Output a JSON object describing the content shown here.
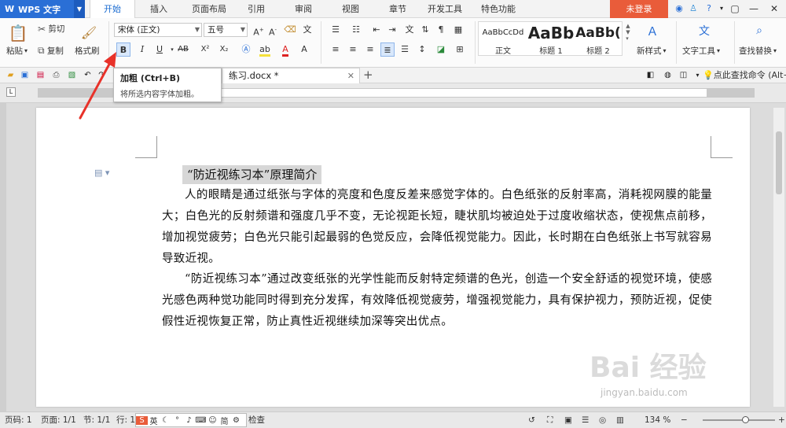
{
  "app": {
    "name": "WPS 文字",
    "menu_tabs": [
      "开始",
      "插入",
      "页面布局",
      "引用",
      "审阅",
      "视图",
      "章节",
      "开发工具",
      "特色功能"
    ],
    "login": "未登录"
  },
  "ribbon": {
    "paste": "粘贴",
    "cut": "剪切",
    "copy": "复制",
    "format_painter": "格式刷",
    "font_name": "宋体 (正文)",
    "font_size": "五号",
    "bold": "B",
    "italic": "I",
    "underline": "U",
    "strike": "AB",
    "superscript": "X²",
    "subscript": "X₂",
    "styles": [
      {
        "preview": "AaBbCcDd",
        "name": "正文"
      },
      {
        "preview": "AaBb",
        "name": "标题 1"
      },
      {
        "preview": "AaBb(",
        "name": "标题 2"
      }
    ],
    "new_style": "新样式",
    "text_tools": "文字工具",
    "find_replace": "查找替换"
  },
  "tabs": {
    "doc_name": "练习.docx *",
    "find_cmd": "点此查找命令 (Alt+"
  },
  "tooltip": {
    "title": "加粗 (Ctrl+B)",
    "desc": "将所选内容字体加粗。"
  },
  "document": {
    "title": "“防近视练习本”原理简介",
    "para1": "人的眼睛是通过纸张与字体的亮度和色度反差来感觉字体的。白色纸张的反射率高，消耗视网膜的能量大；白色光的反射频谱和强度几乎不变，无论视距长短，睫状肌均被迫处于过度收缩状态，使视焦点前移，增加视觉疲劳；白色光只能引起最弱的色觉反应，会降低视觉能力。因此，长时期在白色纸张上书写就容易导致近视。",
    "para2": "“防近视练习本”通过改变纸张的光学性能而反射特定频谱的色光，创造一个安全舒适的视觉环境，使感光感色两种觉功能同时得到充分发挥，有效降低视觉疲劳，增强视觉能力，具有保护视力，预防近视，促使假性近视恢复正常，防止真性近视继续加深等突出优点。"
  },
  "status": {
    "page": "页码: 1",
    "pages": "页面: 1/1",
    "section": "节: 1/1",
    "line": "行: 1",
    "check": "检查",
    "ime_cn": "英",
    "ime_simp": "简",
    "zoom": "134 %"
  },
  "watermark": {
    "text": "Bai 经验",
    "url": "jingyan.baidu.com"
  },
  "colors": {
    "accent": "#2a6fd6",
    "login_bg": "#e95c3a",
    "arrow": "#e8322a"
  }
}
